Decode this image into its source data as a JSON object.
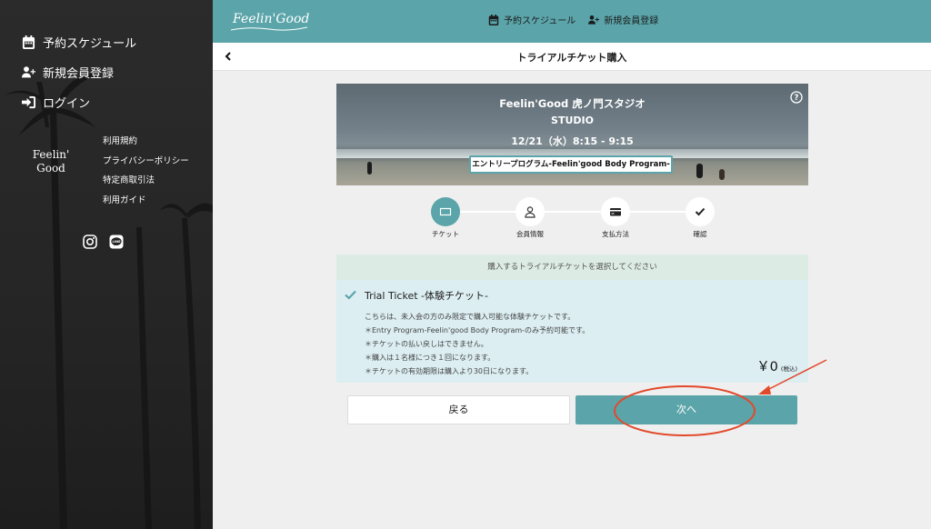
{
  "sidebar": {
    "nav": [
      {
        "label": "予約スケジュール",
        "icon": "calendar-icon"
      },
      {
        "label": "新規会員登録",
        "icon": "add-user-icon"
      },
      {
        "label": "ログイン",
        "icon": "login-icon"
      }
    ],
    "logo_line1": "Feelin'",
    "logo_line2": "Good",
    "links": [
      "利用規約",
      "プライバシーポリシー",
      "特定商取引法",
      "利用ガイド"
    ],
    "social": [
      "instagram-icon",
      "line-icon"
    ]
  },
  "header": {
    "brand": "Feelin'Good",
    "nav": [
      {
        "label": "予約スケジュール",
        "icon": "calendar-icon"
      },
      {
        "label": "新規会員登録",
        "icon": "add-user-icon"
      }
    ],
    "accent": "#5ba5aa"
  },
  "subbar": {
    "title": "トライアルチケット購入",
    "back_icon": "chevron-left-icon"
  },
  "banner": {
    "studio": "Feelin'Good 虎ノ門スタジオ",
    "sub": "STUDIO",
    "date": "12/21（水）8:15 - 9:15",
    "program": "エントリープログラム-Feelin'good Body Program-",
    "help_icon": "help-icon"
  },
  "steps": [
    {
      "label": "チケット",
      "icon": "ticket-icon",
      "active": true
    },
    {
      "label": "会員情報",
      "icon": "user-icon",
      "active": false
    },
    {
      "label": "支払方法",
      "icon": "credit-card-icon",
      "active": false
    },
    {
      "label": "確認",
      "icon": "check-icon",
      "active": false
    }
  ],
  "ticket_section": {
    "prompt": "購入するトライアルチケットを選択してください",
    "ticket": {
      "name": "Trial Ticket -体験チケット-",
      "desc": [
        "こちらは、未入会の方のみ限定で購入可能な体験チケットです。",
        "＊Entry Program-Feelin'good Body Program-のみ予約可能です。",
        "＊チケットの払い戻しはできません。",
        "＊購入は１名様につき１回になります。",
        "＊チケットの有効期限は購入より30日になります。"
      ],
      "price": "￥0",
      "tax": "(税込)",
      "selected": true
    }
  },
  "buttons": {
    "back": "戻る",
    "next": "次へ"
  },
  "annotation_color": "#e2492a"
}
